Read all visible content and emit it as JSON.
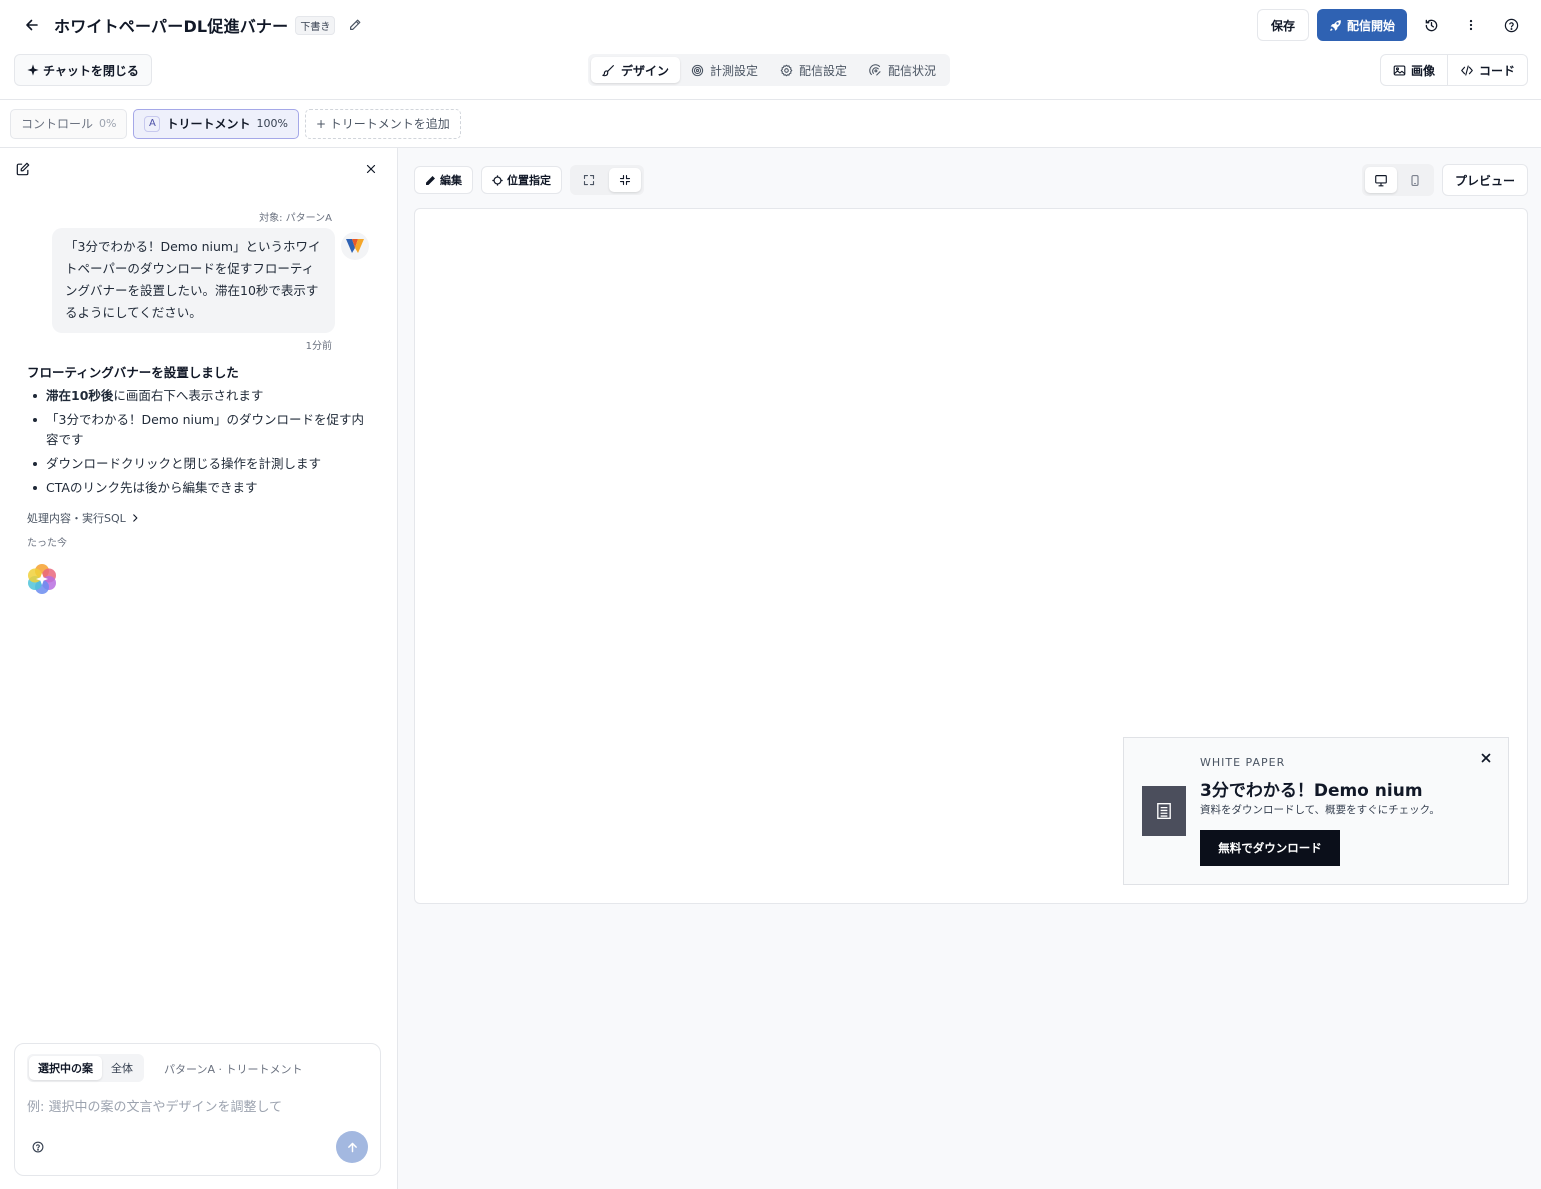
{
  "header": {
    "title": "ホワイトペーパーDL促進バナー",
    "status_badge": "下書き",
    "save_label": "保存",
    "launch_label": "配信開始"
  },
  "toolbar": {
    "close_chat_label": "チャットを閉じる",
    "tabs": [
      {
        "label": "デザイン",
        "icon": "brush-icon",
        "active": true
      },
      {
        "label": "計測設定",
        "icon": "target-icon",
        "active": false
      },
      {
        "label": "配信設定",
        "icon": "gear-icon",
        "active": false
      },
      {
        "label": "配信状況",
        "icon": "signal-icon",
        "active": false
      }
    ],
    "view_image_label": "画像",
    "view_code_label": "コード"
  },
  "variants": [
    {
      "name": "コントロール",
      "percent": "0%",
      "active": false
    },
    {
      "letter": "A",
      "name": "トリートメント",
      "percent": "100%",
      "active": true
    }
  ],
  "add_variant_label": "+ トリートメントを追加",
  "chat": {
    "target_label": "対象: パターンA",
    "user_message": "「3分でわかる！Demo nium」というホワイトペーパーのダウンロードを促すフローティングバナーを設置したい。滞在10秒で表示するようにしてください。",
    "user_time": "1分前",
    "ai_heading": "フローティングバナーを設置しました",
    "ai_items": [
      {
        "bold": "滞在10秒後",
        "text": "に画面右下へ表示されます"
      },
      {
        "bold": "",
        "text": "「3分でわかる！Demo nium」のダウンロードを促す内容です"
      },
      {
        "bold": "",
        "text": "ダウンロードクリックと閉じる操作を計測します"
      },
      {
        "bold": "",
        "text": "CTAのリンク先は後から編集できます"
      }
    ],
    "process_link": "処理内容・実行SQL",
    "ai_time": "たった今"
  },
  "composer": {
    "scope_selected": "選択中の案",
    "scope_all": "全体",
    "scope_label": "パターンA · トリートメント",
    "placeholder": "例: 選択中の案の文言やデザインを調整して",
    "value": ""
  },
  "canvas": {
    "edit_label": "編集",
    "position_label": "位置指定",
    "preview_label": "プレビュー"
  },
  "banner": {
    "eyebrow": "WHITE PAPER",
    "title": "3分でわかる！Demo nium",
    "description": "資料をダウンロードして、概要をすぐにチェック。",
    "cta": "無料でダウンロード"
  },
  "colors": {
    "primary": "#2f62b3",
    "banner_cta_bg": "#0b0f1a",
    "banner_icon_bg": "#4b4e5c",
    "variant_active_bg": "#eef0fb"
  }
}
